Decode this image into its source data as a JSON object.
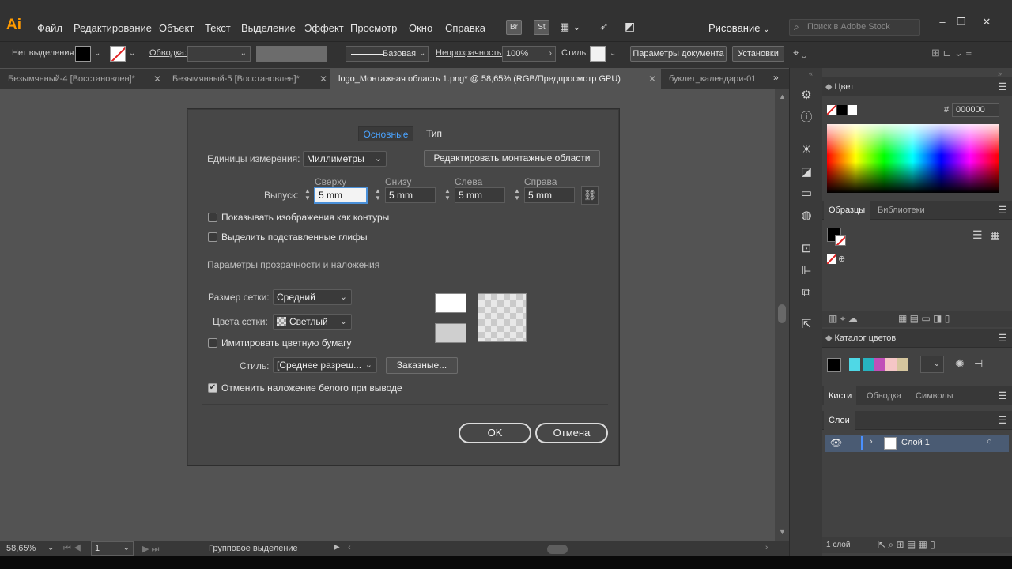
{
  "app": {
    "logo": "Ai"
  },
  "menu": [
    "Файл",
    "Редактирование",
    "Объект",
    "Текст",
    "Выделение",
    "Эффект",
    "Просмотр",
    "Окно",
    "Справка"
  ],
  "topbar": {
    "br": "Br",
    "st": "St",
    "workspace": "Рисование",
    "search_placeholder": "Поиск в Adobe Stock"
  },
  "controlbar": {
    "no_selection": "Нет выделения",
    "stroke_label": "Обводка:",
    "brush_label": "Базовая",
    "opacity_label": "Непрозрачность:",
    "opacity_value": "100%",
    "style_label": "Стиль:",
    "doc_setup": "Параметры документа",
    "preferences": "Установки"
  },
  "tabs": [
    {
      "label": "Безымянный-4 [Восстановлен]*"
    },
    {
      "label": "Безымянный-5 [Восстановлен]*"
    },
    {
      "label": "logo_Монтажная область 1.png* @ 58,65% (RGB/Предпросмотр GPU)"
    },
    {
      "label": "буклет_календари-01"
    }
  ],
  "dialog": {
    "tabs": {
      "basic": "Основные",
      "type": "Тип"
    },
    "units_label": "Единицы измерения:",
    "units_value": "Миллиметры",
    "edit_artboards": "Редактировать монтажные области",
    "bleed_label": "Выпуск:",
    "bleed": {
      "top_label": "Сверху",
      "top": "5 mm",
      "bottom_label": "Снизу",
      "bottom": "5 mm",
      "left_label": "Слева",
      "left": "5 mm",
      "right_label": "Справа",
      "right": "5 mm"
    },
    "show_outlines": "Показывать изображения как контуры",
    "highlight_glyphs": "Выделить подставленные глифы",
    "transparency_section": "Параметры прозрачности и наложения",
    "grid_size_label": "Размер сетки:",
    "grid_size_value": "Средний",
    "grid_colors_label": "Цвета сетки:",
    "grid_colors_value": "Светлый",
    "simulate_paper": "Имитировать цветную бумагу",
    "style_label": "Стиль:",
    "style_value": "[Среднее разреш...",
    "custom": "Заказные...",
    "discard_white": "Отменить наложение белого при выводе",
    "ok": "OK",
    "cancel": "Отмена",
    "checks": {
      "show_outlines": false,
      "highlight_glyphs": false,
      "simulate_paper": false,
      "discard_white": true
    }
  },
  "status": {
    "zoom": "58,65%",
    "artboard": "1",
    "tool": "Групповое выделение"
  },
  "panels": {
    "color": {
      "title": "Цвет",
      "hash": "#",
      "hex": "000000"
    },
    "swatches": {
      "tab": "Образцы",
      "libraries": "Библиотеки"
    },
    "color_guide": {
      "title": "Каталог цветов",
      "colors": [
        "#4fd8e6",
        "#27b3c0",
        "#c04fb8",
        "#f5c6c6",
        "#d6c69e"
      ]
    },
    "brushes": {
      "tab1": "Кисти",
      "tab2": "Обводка",
      "tab3": "Символы"
    },
    "layers": {
      "title": "Слои",
      "layer_name": "Слой 1",
      "count": "1 слой"
    }
  }
}
